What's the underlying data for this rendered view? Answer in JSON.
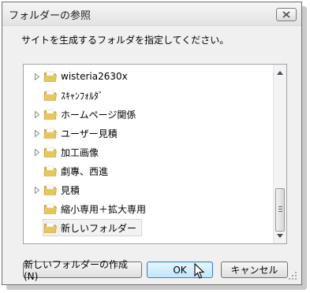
{
  "dialog": {
    "title": "フォルダーの参照",
    "instruction": "サイトを生成するフォルダを指定してください。"
  },
  "tree": {
    "items": [
      {
        "label": "wisteria2630x",
        "expandable": true,
        "selected": false
      },
      {
        "label": "ｽｷｬﾝﾌｫﾙﾀﾞ",
        "expandable": false,
        "selected": false
      },
      {
        "label": "ホームページ関係",
        "expandable": true,
        "selected": false
      },
      {
        "label": "ユーザー見積",
        "expandable": true,
        "selected": false
      },
      {
        "label": "加工画像",
        "expandable": true,
        "selected": false
      },
      {
        "label": "劇專、西進",
        "expandable": false,
        "selected": false
      },
      {
        "label": "見積",
        "expandable": true,
        "selected": false
      },
      {
        "label": "縮小専用＋拡大専用",
        "expandable": false,
        "selected": false
      },
      {
        "label": "新しいフォルダー",
        "expandable": false,
        "selected": true
      }
    ]
  },
  "buttons": {
    "new_folder": "新しいフォルダーの作成(N)",
    "ok": "OK",
    "cancel": "キャンセル"
  },
  "colors": {
    "folder": "#e8c75a",
    "dialog_bg": "#f0f0f0",
    "ok_border": "#3c7fb1"
  },
  "icons": {
    "close": "close-icon",
    "expand": "expand-arrow-icon",
    "folder": "folder-icon"
  }
}
